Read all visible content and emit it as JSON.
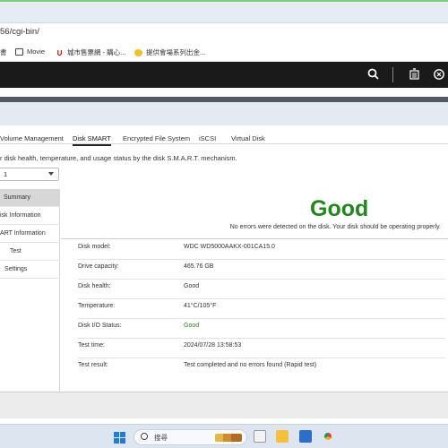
{
  "browser": {
    "address_text": "56/cgi-bin/",
    "bookmarks": [
      {
        "label": "書",
        "icon": "none"
      },
      {
        "label": "Movie",
        "icon": "folder-icon"
      },
      {
        "label": "城市售票網 - 購心...",
        "icon": "u-icon"
      },
      {
        "label": "提供會場系列出金...",
        "icon": "yellow-circle-icon"
      }
    ]
  },
  "header": {
    "icons": [
      "search-icon",
      "task-icon",
      "sync-icon"
    ]
  },
  "tabs": [
    {
      "label": "Volume Management",
      "active": false
    },
    {
      "label": "Disk SMART",
      "active": true
    },
    {
      "label": "Encrypted File System",
      "active": false
    },
    {
      "label": "iSCSI",
      "active": false
    },
    {
      "label": "Virtual Disk",
      "active": false
    }
  ],
  "description": "r disk health, temperature, and usage status by the disk S.M.A.R.T. mechanism.",
  "disk_select": {
    "value": "1"
  },
  "nav": [
    {
      "label": "Summary",
      "selected": true
    },
    {
      "label": "isk Information",
      "selected": false
    },
    {
      "label": "ART Information",
      "selected": false
    },
    {
      "label": "Test",
      "selected": false
    },
    {
      "label": "Settings",
      "selected": false
    }
  ],
  "summary": {
    "status": "Good",
    "message": "No errors were detected on the disk. Your disk should be operating properly.",
    "status_color": "#1e8a1a"
  },
  "details": [
    {
      "label": "Disk model:",
      "value": "WDC WD5000AAKX-001CA15.0"
    },
    {
      "label": "Drive capacity:",
      "value": "465.76 GB"
    },
    {
      "label": "Disk health:",
      "value": "Good"
    },
    {
      "label": "Temperature:",
      "value": "41°C/105°F"
    },
    {
      "label": "Disk I/O Status:",
      "value": "Good"
    },
    {
      "label": "Test time:",
      "value": "2024/07/28 13:58:53"
    },
    {
      "label": "Test result:",
      "value": "Test completed and no errors found (Rapid test)"
    }
  ],
  "taskbar": {
    "search_text": "搜尋"
  }
}
